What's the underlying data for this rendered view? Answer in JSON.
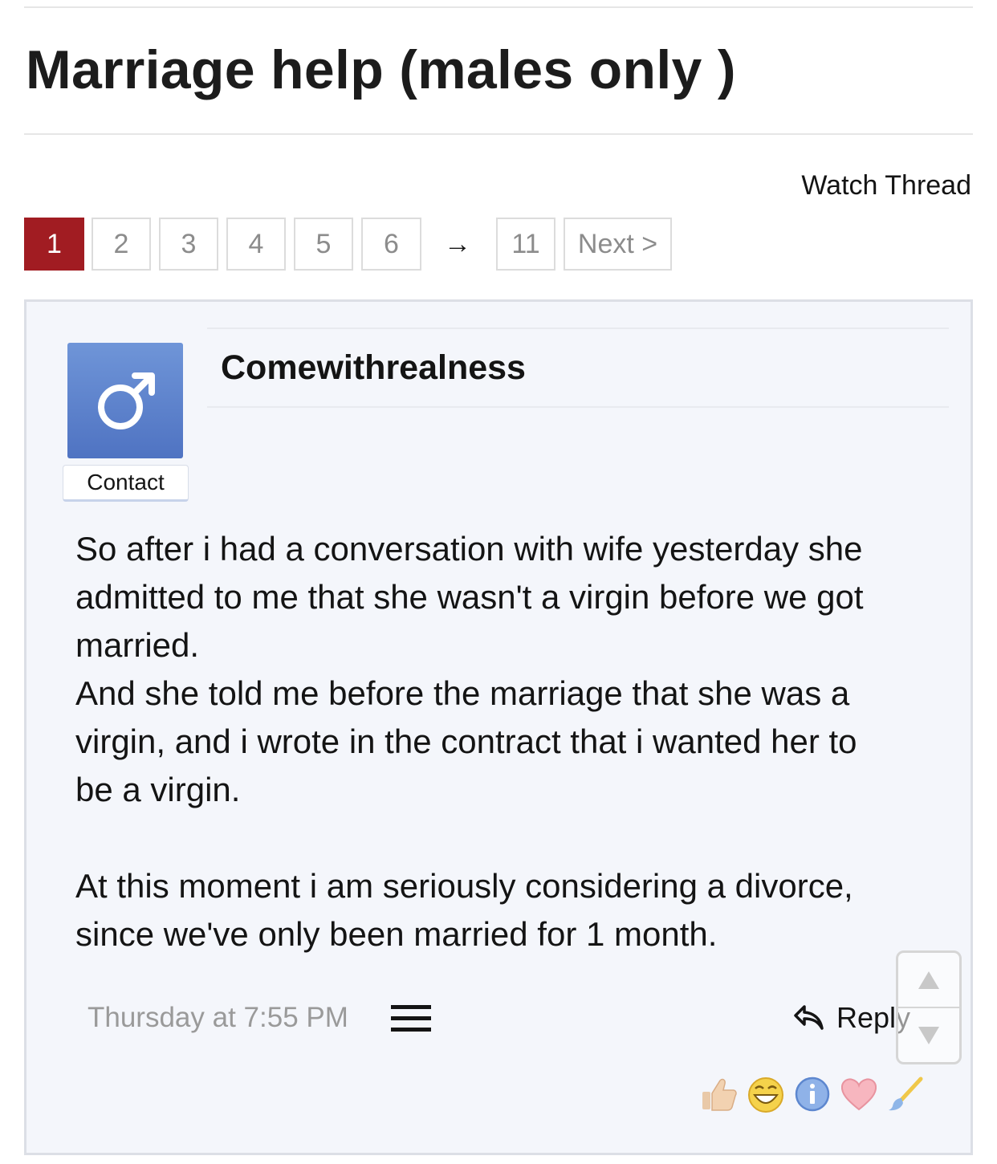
{
  "thread": {
    "title": "Marriage help (males only )",
    "watch_label": "Watch Thread"
  },
  "pagination": {
    "pages": [
      "1",
      "2",
      "3",
      "4",
      "5",
      "6"
    ],
    "current": "1",
    "ellipsis": "→",
    "last": "11",
    "next_label": "Next >"
  },
  "post": {
    "author": "Comewithrealness",
    "avatar_icon": "male-symbol-icon",
    "contact_label": "Contact",
    "message_lines": [
      "So after i had a conversation with wife yesterday she",
      "admitted to me that she wasn't a virgin before we got",
      "married.",
      "And she told me before the marriage that she was a",
      "virgin, and i wrote in the contract that i wanted her to",
      "be a virgin.",
      "At this moment i am seriously considering a divorce,",
      "since we've only been married for 1 month."
    ],
    "date": "Thursday at 7:55 PM",
    "reply_label": "Reply",
    "reactions": [
      "thumbs-up-icon",
      "laughing-face-icon",
      "info-icon",
      "heart-icon",
      "paintbrush-icon"
    ]
  },
  "colors": {
    "accent_current_page": "#a11c22",
    "avatar_blue": "#5a80cc",
    "post_background": "#f4f6fb"
  }
}
